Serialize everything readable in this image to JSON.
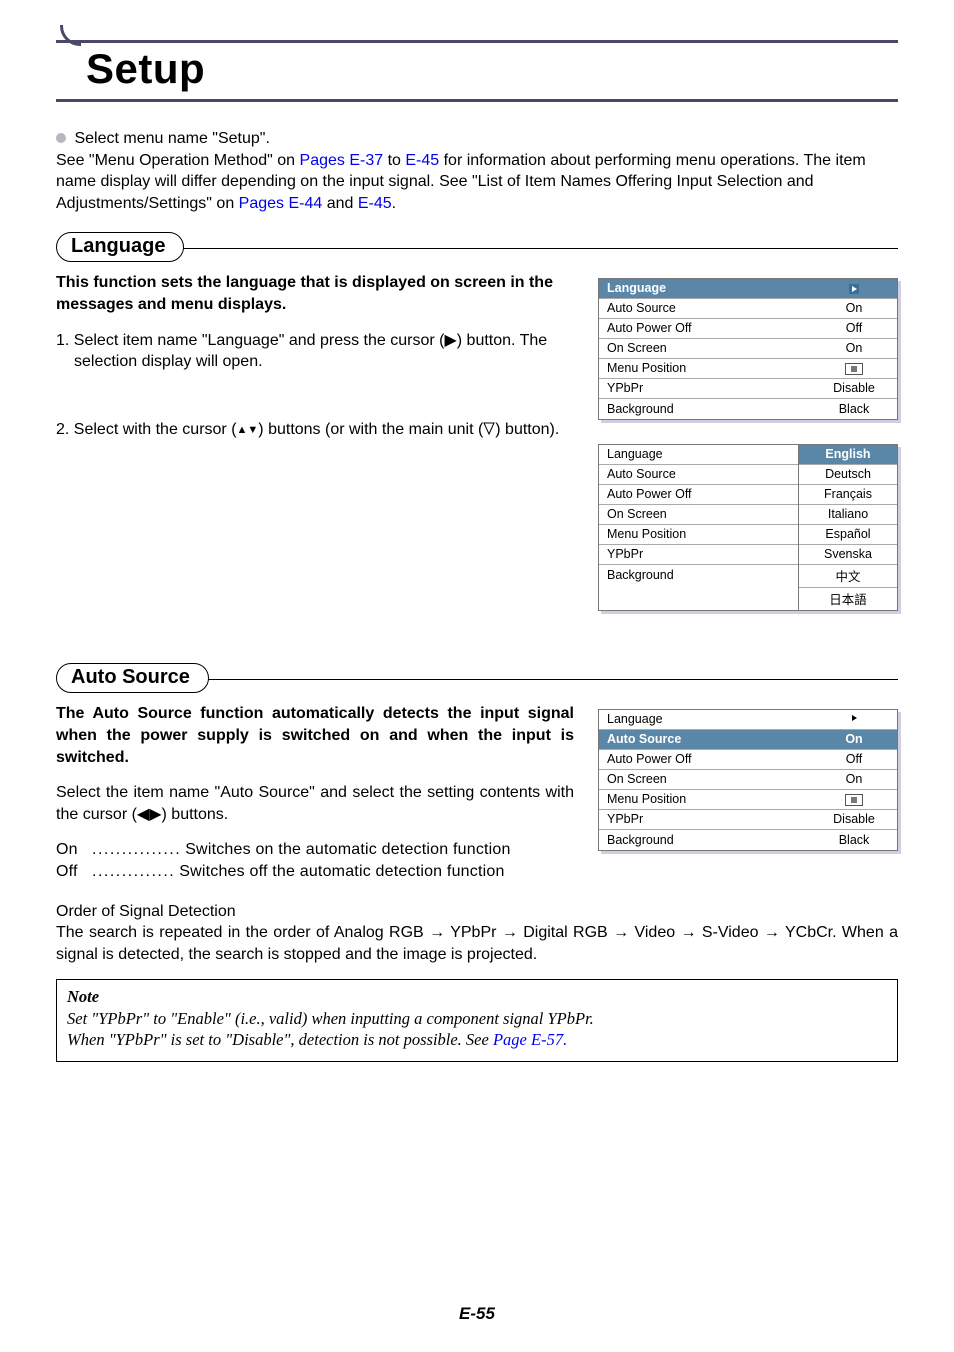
{
  "page": {
    "title": "Setup",
    "number": "E-55"
  },
  "intro": {
    "bullet_line": "Select menu name \"Setup\".",
    "line2_pre": "See \"Menu Operation Method\" on ",
    "link1": "Pages E-37",
    "line2_mid1": " to ",
    "link2": "E-45",
    "line2_post": " for information about performing menu operations. The item name display will differ depending on the input signal. See \"List of Item Names Offering Input Selection and Adjustments/Settings\" on ",
    "link3": "Pages E-44",
    "line2_mid2": " and ",
    "link4": "E-45",
    "line2_end": "."
  },
  "section_language": {
    "heading": "Language",
    "lead": "This function sets the language that is displayed on screen in the messages and menu displays.",
    "step1": "1. Select item name \"Language\" and press the cursor (▶) button. The selection display will open.",
    "step2": "2. Select with the cursor (▲▼) buttons (or with the main unit (  ) button)."
  },
  "section_auto_source": {
    "heading": "Auto Source",
    "lead": "The Auto Source function automatically detects the input signal when the power supply is switched on and when the input is switched.",
    "para": "Select the item name \"Auto Source\" and select the setting contents with the cursor (◀▶) buttons.",
    "on_label": "On",
    "on_desc": "Switches on the automatic detection function",
    "off_label": "Off",
    "off_desc": "Switches off the automatic detection function",
    "order_title": "Order of Signal Detection",
    "order_body": "The search is repeated in the order of Analog RGB → YPbPr → Digital RGB → Video → S-Video → YCbCr. When a signal is detected, the search is stopped and the image is projected."
  },
  "note": {
    "title": "Note",
    "l1": "Set \"YPbPr\" to \"Enable\" (i.e., valid) when inputting a component signal YPbPr.",
    "l2_pre": "When \"YPbPr\" is set to \"Disable\", detection is not possible. See ",
    "l2_link": "Page E-57."
  },
  "menu1": {
    "rows": [
      {
        "label": "Language",
        "value": "▶",
        "hl": true
      },
      {
        "label": "Auto Source",
        "value": "On"
      },
      {
        "label": "Auto Power Off",
        "value": "Off"
      },
      {
        "label": "On Screen",
        "value": "On"
      },
      {
        "label": "Menu Position",
        "value": "__icon__"
      },
      {
        "label": "YPbPr",
        "value": "Disable"
      },
      {
        "label": "Background",
        "value": "Black"
      }
    ]
  },
  "menu2_left": [
    "Language",
    "Auto Source",
    "Auto Power Off",
    "On Screen",
    "Menu Position",
    "YPbPr",
    "Background"
  ],
  "menu2_right": [
    "English",
    "Deutsch",
    "Français",
    "Italiano",
    "Español",
    "Svenska",
    "中文",
    "日本語"
  ],
  "menu3": {
    "rows": [
      {
        "label": "Language",
        "value": "▶"
      },
      {
        "label": "Auto Source",
        "value": "On",
        "hl": true
      },
      {
        "label": "Auto Power Off",
        "value": "Off"
      },
      {
        "label": "On Screen",
        "value": "On"
      },
      {
        "label": "Menu Position",
        "value": "__icon__"
      },
      {
        "label": "YPbPr",
        "value": "Disable"
      },
      {
        "label": "Background",
        "value": "Black"
      }
    ]
  }
}
